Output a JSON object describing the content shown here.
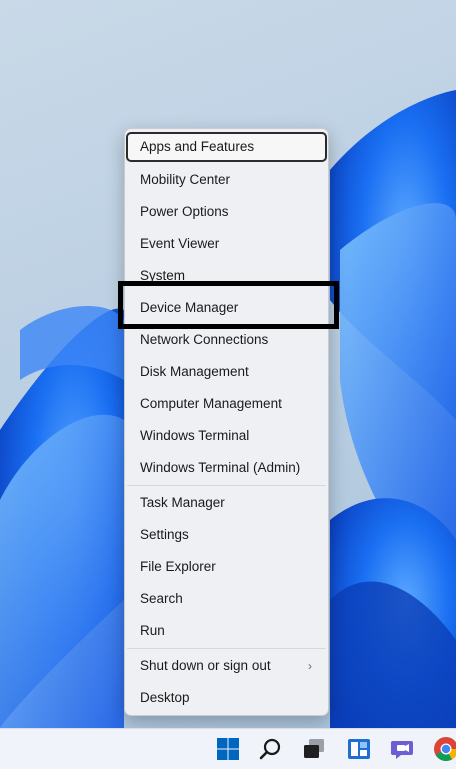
{
  "menu": {
    "items": [
      {
        "label": "Apps and Features"
      },
      {
        "label": "Mobility Center"
      },
      {
        "label": "Power Options"
      },
      {
        "label": "Event Viewer"
      },
      {
        "label": "System"
      },
      {
        "label": "Device Manager"
      },
      {
        "label": "Network Connections"
      },
      {
        "label": "Disk Management"
      },
      {
        "label": "Computer Management"
      },
      {
        "label": "Windows Terminal"
      },
      {
        "label": "Windows Terminal (Admin)"
      },
      {
        "label": "Task Manager"
      },
      {
        "label": "Settings"
      },
      {
        "label": "File Explorer"
      },
      {
        "label": "Search"
      },
      {
        "label": "Run"
      },
      {
        "label": "Shut down or sign out"
      },
      {
        "label": "Desktop"
      }
    ],
    "submenu_chevron": "›"
  },
  "taskbar": {
    "icons": [
      "windows-start-icon",
      "search-icon",
      "task-view-icon",
      "widgets-icon",
      "teams-chat-icon",
      "chrome-icon"
    ],
    "accent": "#0067c0"
  }
}
